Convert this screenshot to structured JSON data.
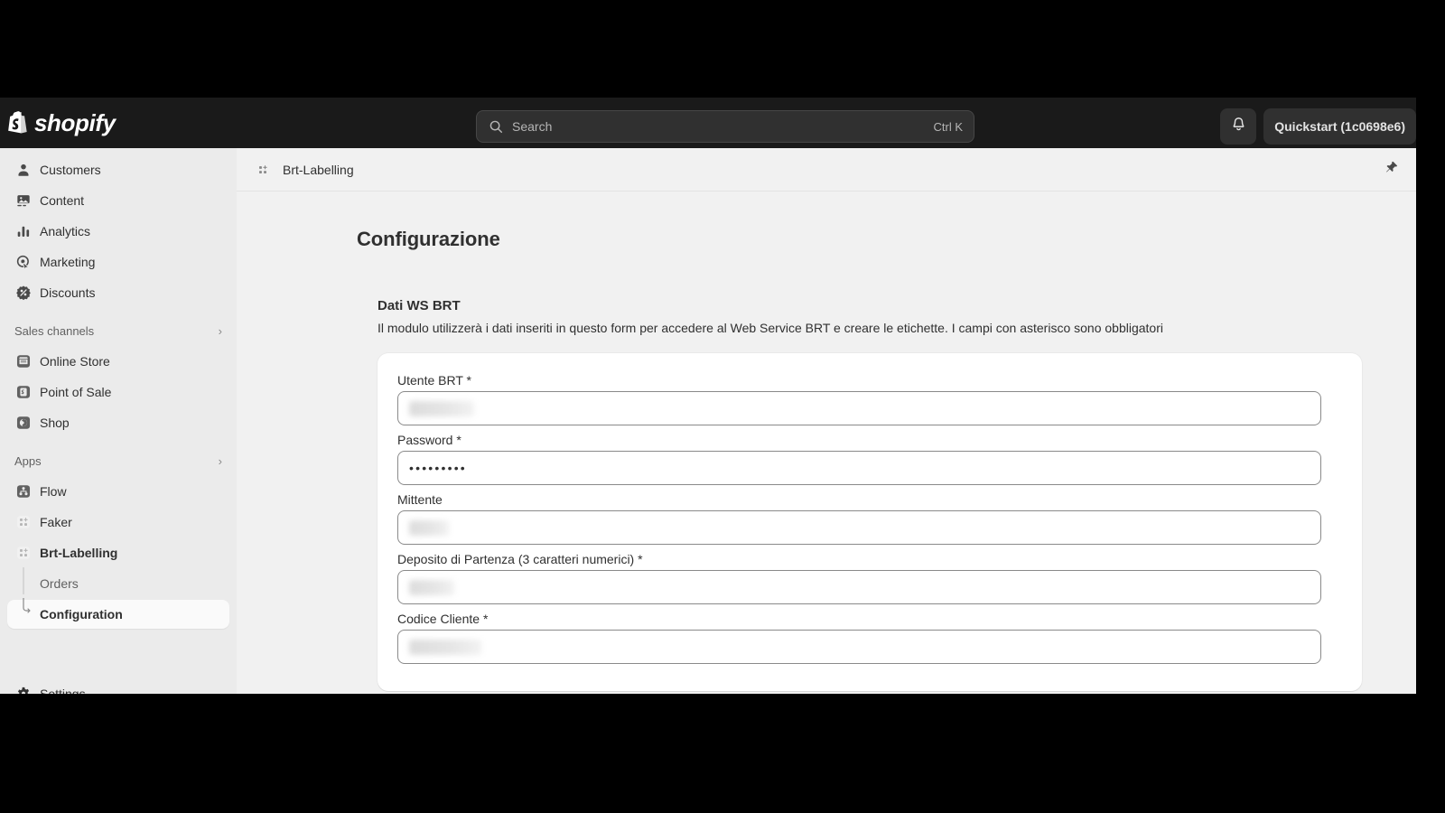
{
  "topbar": {
    "brand": "shopify",
    "search": {
      "placeholder": "Search",
      "shortcut": "Ctrl K",
      "icon": "search-icon"
    },
    "notifications_icon": "bell-icon",
    "store_name": "Quickstart (1c0698e6)"
  },
  "sidebar": {
    "primary_items": [
      {
        "label": "Customers",
        "icon": "person-icon"
      },
      {
        "label": "Content",
        "icon": "image-icon"
      },
      {
        "label": "Analytics",
        "icon": "bar-chart-icon"
      },
      {
        "label": "Marketing",
        "icon": "target-icon"
      },
      {
        "label": "Discounts",
        "icon": "discount-badge-icon"
      }
    ],
    "sales_channels": {
      "title": "Sales channels",
      "chevron": "›",
      "items": [
        {
          "label": "Online Store",
          "icon": "storefront-icon"
        },
        {
          "label": "Point of Sale",
          "icon": "pos-icon"
        },
        {
          "label": "Shop",
          "icon": "shop-icon"
        }
      ]
    },
    "apps": {
      "title": "Apps",
      "chevron": "›",
      "items": [
        {
          "label": "Flow",
          "icon": "flow-app-icon"
        },
        {
          "label": "Faker",
          "icon": "app-placeholder-icon"
        },
        {
          "label": "Brt-Labelling",
          "icon": "app-placeholder-icon"
        }
      ],
      "subitems": [
        {
          "label": "Orders",
          "active": false
        },
        {
          "label": "Configuration",
          "active": true
        }
      ]
    },
    "settings": {
      "label": "Settings",
      "icon": "gear-icon"
    }
  },
  "app_header": {
    "app_name": "Brt-Labelling",
    "app_icon": "app-placeholder-icon",
    "pin_icon": "pin-icon"
  },
  "page": {
    "title": "Configurazione",
    "section_title": "Dati WS BRT",
    "section_description": "Il modulo utilizzerà i dati inseriti in questo form per accedere al Web Service BRT e creare le etichette. I campi con asterisco sono obbligatori",
    "fields": [
      {
        "label": "Utente BRT *",
        "value": "",
        "masked": true,
        "blur_width": 72
      },
      {
        "label": "Password *",
        "value": "•••••••••",
        "masked": false,
        "blur_width": 0
      },
      {
        "label": "Mittente",
        "value": "",
        "masked": true,
        "blur_width": 44
      },
      {
        "label": "Deposito di Partenza (3 caratteri numerici) *",
        "value": "",
        "masked": true,
        "blur_width": 50
      },
      {
        "label": "Codice Cliente *",
        "value": "",
        "masked": true,
        "blur_width": 80
      }
    ]
  },
  "colors": {
    "topbar_bg": "#1a1a1a",
    "sidebar_bg": "#ebebeb",
    "content_bg": "#f1f1f1",
    "card_bg": "#ffffff",
    "text_primary": "#303030",
    "text_secondary": "#616161"
  }
}
